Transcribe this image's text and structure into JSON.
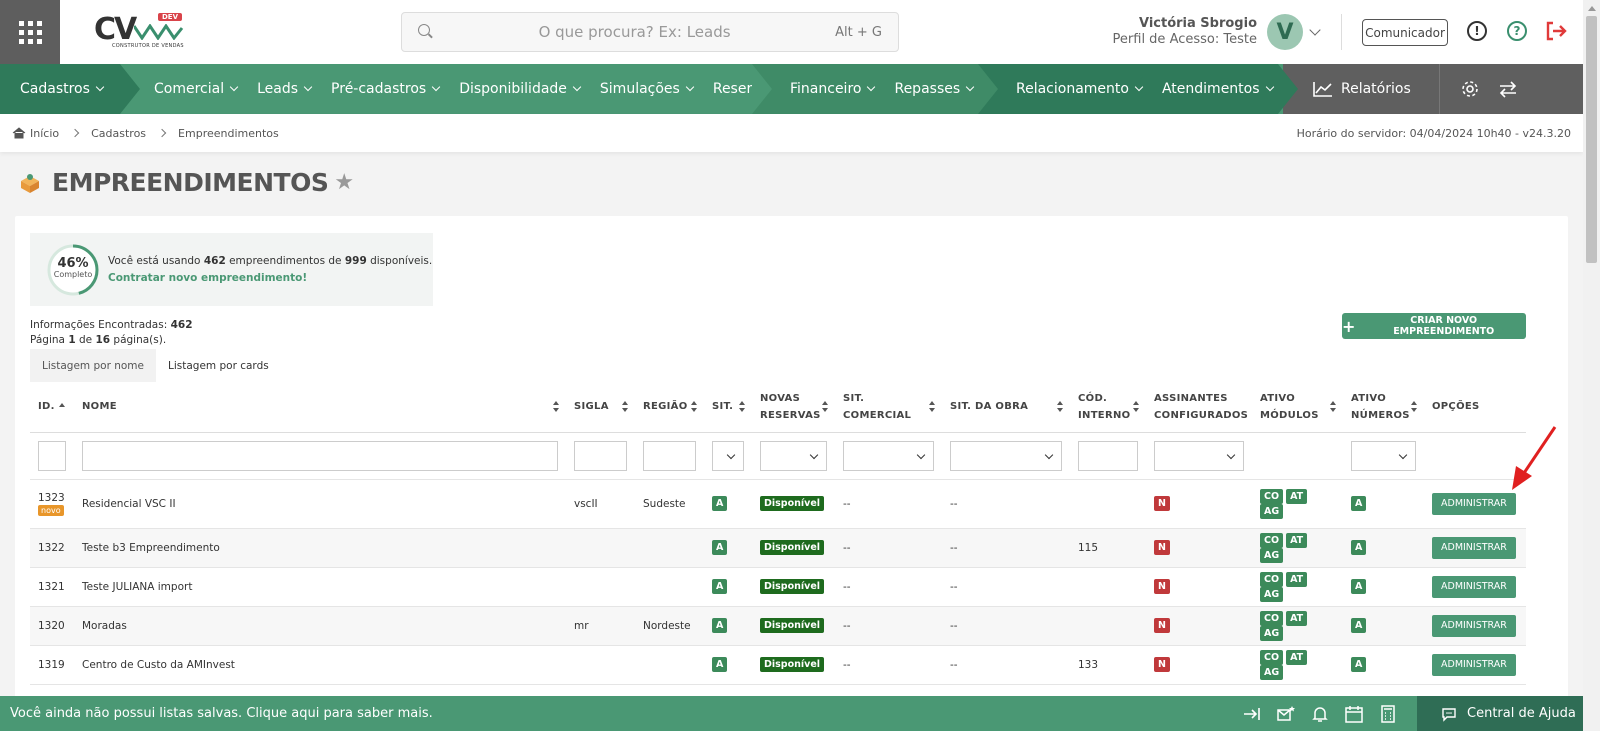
{
  "header": {
    "logo_main": "CV",
    "logo_badge": "DEV",
    "logo_sub": "CONSTRUTOR DE VENDAS",
    "search_placeholder": "O que procura? Ex: Leads",
    "search_shortcut": "Alt + G",
    "user_name": "Victória Sbrogio",
    "user_profile": "Perfil de Acesso: Teste",
    "avatar_initial": "V",
    "comunicador_label": "Comunicador",
    "info_glyph": "!",
    "help_glyph": "?"
  },
  "nav": {
    "items": [
      {
        "label": "Cadastros"
      },
      {
        "label": "Comercial"
      },
      {
        "label": "Leads"
      },
      {
        "label": "Pré-cadastros"
      },
      {
        "label": "Disponibilidade"
      },
      {
        "label": "Simulações"
      },
      {
        "label": "Reservas"
      },
      {
        "label": "Financeiro"
      },
      {
        "label": "Repasses"
      },
      {
        "label": "Relacionamento"
      },
      {
        "label": "Atendimentos"
      }
    ],
    "reports_label": "Relatórios"
  },
  "breadcrumb": {
    "items": [
      "Início",
      "Cadastros",
      "Empreendimentos"
    ],
    "server_time": "Horário do servidor: 04/04/2024 10h40 - v24.3.20"
  },
  "page": {
    "title": "EMPREENDIMENTOS",
    "usage": {
      "percent_value": 46,
      "percent_text": "46%",
      "percent_label": "Completo",
      "text_before": "Você está usando ",
      "used": "462",
      "text_mid": " empreendimentos de ",
      "total": "999",
      "text_after": " disponíveis.",
      "link": "Contratar novo empreendimento!"
    },
    "found_label": "Informações Encontradas: ",
    "found_count": "462",
    "page_label_1": "Página ",
    "page_current": "1",
    "page_label_2": " de ",
    "page_total": "16",
    "page_label_3": " página(s).",
    "create_button": "CRIAR NOVO EMPREENDIMENTO",
    "tabs": [
      {
        "label": "Listagem por nome",
        "active": true
      },
      {
        "label": "Listagem por cards",
        "active": false
      }
    ]
  },
  "table": {
    "headers": {
      "id": "ID.",
      "nome": "NOME",
      "sigla": "SIGLA",
      "regiao": "REGIÃO",
      "sit": "SIT.",
      "novas_reservas_1": "NOVAS",
      "novas_reservas_2": "RESERVAS",
      "sit_comercial_1": "SIT.",
      "sit_comercial_2": "COMERCIAL",
      "sit_obra": "SIT. DA OBRA",
      "cod_interno_1": "CÓD.",
      "cod_interno_2": "INTERNO",
      "assinantes_1": "ASSINANTES",
      "assinantes_2": "CONFIGURADOS",
      "ativo_modulos_1": "ATIVO",
      "ativo_modulos_2": "MÓDULOS",
      "ativo_numeros_1": "ATIVO",
      "ativo_numeros_2": "NÚMEROS",
      "opcoes": "OPÇÕES"
    },
    "rows": [
      {
        "id": "1323",
        "novo": "novo",
        "nome": "Residencial VSC II",
        "sigla": "vscII",
        "regiao": "Sudeste",
        "sit": "A",
        "novas": "Disponível",
        "sit_comercial": "--",
        "sit_obra": "--",
        "cod": "",
        "assin": "N",
        "mod": [
          "CO",
          "AT",
          "AG"
        ],
        "num": "A",
        "action": "ADMINISTRAR"
      },
      {
        "id": "1322",
        "novo": "",
        "nome": "Teste b3 Empreendimento",
        "sigla": "",
        "regiao": "",
        "sit": "A",
        "novas": "Disponível",
        "sit_comercial": "--",
        "sit_obra": "--",
        "cod": "115",
        "assin": "N",
        "mod": [
          "CO",
          "AT",
          "AG"
        ],
        "num": "A",
        "action": "ADMINISTRAR"
      },
      {
        "id": "1321",
        "novo": "",
        "nome": "Teste JULIANA import",
        "sigla": "",
        "regiao": "",
        "sit": "A",
        "novas": "Disponível",
        "sit_comercial": "--",
        "sit_obra": "--",
        "cod": "",
        "assin": "N",
        "mod": [
          "CO",
          "AT",
          "AG"
        ],
        "num": "A",
        "action": "ADMINISTRAR"
      },
      {
        "id": "1320",
        "novo": "",
        "nome": "Moradas",
        "sigla": "mr",
        "regiao": "Nordeste",
        "sit": "A",
        "novas": "Disponível",
        "sit_comercial": "--",
        "sit_obra": "--",
        "cod": "",
        "assin": "N",
        "mod": [
          "CO",
          "AT",
          "AG"
        ],
        "num": "A",
        "action": "ADMINISTRAR"
      },
      {
        "id": "1319",
        "novo": "",
        "nome": "Centro de Custo da AMInvest",
        "sigla": "",
        "regiao": "",
        "sit": "A",
        "novas": "Disponível",
        "sit_comercial": "--",
        "sit_obra": "--",
        "cod": "133",
        "assin": "N",
        "mod": [
          "CO",
          "AT",
          "AG"
        ],
        "num": "A",
        "action": "ADMINISTRAR"
      }
    ]
  },
  "footer": {
    "message": "Você ainda não possui listas salvas. Clique aqui para saber mais.",
    "help_center": "Central de Ajuda"
  },
  "colors": {
    "primary_green": "#4a9874",
    "dark_green": "#2f7a5a",
    "badge_red": "#c0393b",
    "badge_green": "#3c8a5a",
    "orange": "#e8962a"
  }
}
